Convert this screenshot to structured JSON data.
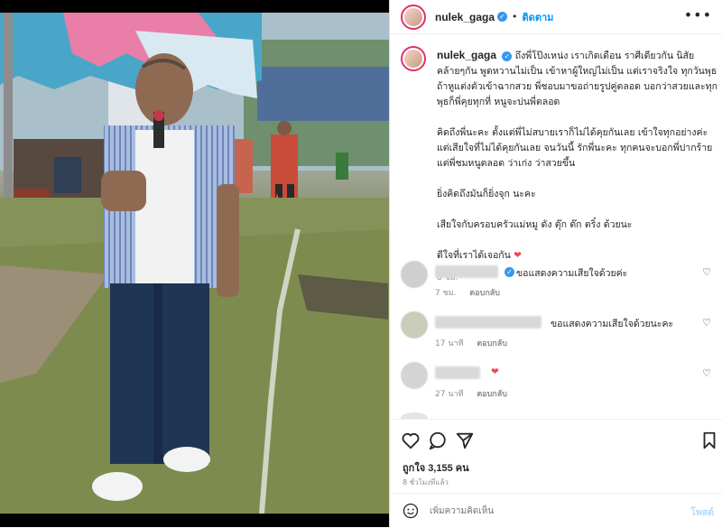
{
  "post": {
    "username": "nulek_gaga",
    "follow_label": "ติดตาม",
    "more_icon": "more-horizontal-icon",
    "caption": {
      "username": "nulek_gaga",
      "paragraphs": [
        "ถึงพี่โป๊งเหน่ง เราเกิดเดือน ราศีเดียวกัน นิสัยคล้ายๆกัน พูดหวานไม่เป็น เข้าหาผู้ใหญ่ไม่เป็น แต่เราจริงใจ ทุกวันพุธ ถ้าหูแต่งตัวเข้าฉากสวย พี่ชอบมาขอถ่ายรูปคู่ตลอด บอกว่าสวยและทุกพุธก็พี่คุยทุกที่ หนูจะบ่นพี่ตลอด",
        "คิดถึงพี่นะคะ ตั้งแต่พี่ไม่สบายเราก็ไม่ได้คุยกันเลย เข้าใจทุกอย่างค่ะ แต่เสียใจที่ไม่ได้คุยกันเลย จนวันนี้ รักพี่นะคะ ทุกคนจะบอกพี่ปากร้าย แต่พี่ชมหนูตลอด ว่าเก่ง ว่าสวยขึ้น",
        "ยิ่งคิดถึงมันก็ยิ่งจุก นะคะ",
        "เสียใจกับครอบครัวแม่หมู ดัง ตุ๊ก ต๊ก ตริ๋ง ด้วยนะ",
        "ดีใจที่เราได้เจอกัน"
      ],
      "time": "8 ชม."
    },
    "comments": [
      {
        "text": "ขอแสดงความเสียใจด้วยค่ะ",
        "time": "7 ชม.",
        "reply": "ตอบกลับ"
      },
      {
        "text": "ขอแสดงความเสียใจด้วยนะคะ",
        "time": "17 นาที",
        "reply": "ตอบกลับ"
      },
      {
        "text": "",
        "time": "27 นาที",
        "reply": "ตอบกลับ"
      }
    ],
    "likes": "ถูกใจ 3,155 คน",
    "posted": "8 ชั่วโมงที่แล้ว",
    "comment_placeholder": "เพิ่มความคิดเห็น",
    "post_label": "โพสต์",
    "colors": {
      "accent": "#0095f6",
      "heart": "#ed4956",
      "muted": "#8e8e8e"
    }
  }
}
